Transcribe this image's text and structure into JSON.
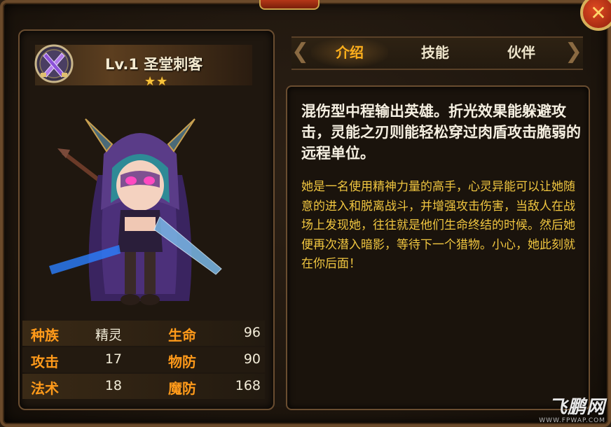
{
  "hero": {
    "name": "Lv.1 圣堂刺客",
    "stars": "★★",
    "class_icon": "crossed-daggers-icon"
  },
  "tabs": [
    {
      "label": "介绍",
      "active": true
    },
    {
      "label": "技能",
      "active": false
    },
    {
      "label": "伙伴",
      "active": false
    }
  ],
  "stats": [
    {
      "label1": "种族",
      "value1": "精灵",
      "label2": "生命",
      "value2": "96"
    },
    {
      "label1": "攻击",
      "value1": "17",
      "label2": "物防",
      "value2": "90"
    },
    {
      "label1": "法术",
      "value1": "18",
      "label2": "魔防",
      "value2": "168"
    }
  ],
  "description": {
    "main": "混伤型中程输出英雄。折光效果能躲避攻击，灵能之刃则能轻松穿过肉盾攻击脆弱的远程单位。",
    "sub": "她是一名使用精神力量的高手，心灵异能可以让她随意的进入和脱离战斗，并增强攻击伤害，当敌人在战场上发现她，往往就是他们生命终结的时候。然后她便再次潜入暗影，等待下一个猎物。小心，她此刻就在你后面！"
  },
  "close_button": {
    "label": "✕"
  },
  "watermark": {
    "main": "飞鹏网",
    "sub": "WWW.FPWAP.COM"
  },
  "colors": {
    "accent": "#ffb01c",
    "stat_label": "#ff9a1a",
    "sub_text": "#f0c640"
  }
}
